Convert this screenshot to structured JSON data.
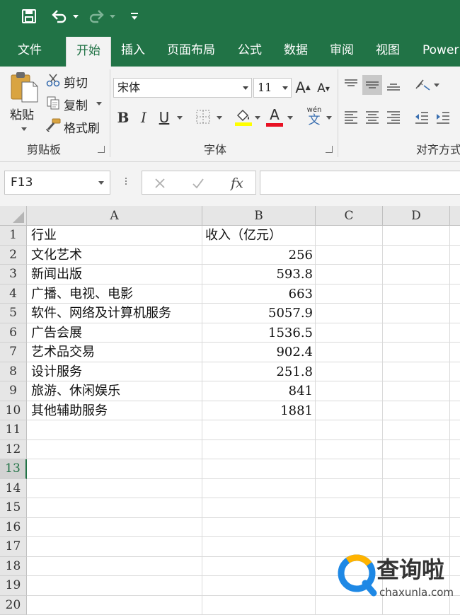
{
  "qat": {
    "save": "save-icon",
    "undo": "undo-icon",
    "redo": "redo-icon",
    "customize": "customize-icon"
  },
  "tabs": [
    "文件",
    "开始",
    "插入",
    "页面布局",
    "公式",
    "数据",
    "审阅",
    "视图",
    "Power"
  ],
  "active_tab": "开始",
  "clipboard": {
    "paste": "粘贴",
    "cut": "剪切",
    "copy": "复制",
    "format_painter": "格式刷",
    "group": "剪贴板"
  },
  "font": {
    "name": "宋体",
    "size": "11",
    "group": "字体",
    "bold": "B",
    "italic": "I",
    "underline": "U",
    "font_color_letter": "A",
    "phonetic_top": "wén",
    "phonetic_bottom": "文",
    "fill_color": "#ffff00",
    "font_color": "#e81123"
  },
  "alignment": {
    "group": "对齐方式"
  },
  "formula_bar": {
    "name_box": "F13",
    "fx": "fx",
    "formula": ""
  },
  "columns": [
    "A",
    "B",
    "C",
    "D"
  ],
  "row_numbers": [
    "1",
    "2",
    "3",
    "4",
    "5",
    "6",
    "7",
    "8",
    "9",
    "10",
    "11",
    "12",
    "13",
    "14",
    "15",
    "16",
    "17",
    "18",
    "19",
    "20"
  ],
  "selected_row": "13",
  "rows": [
    {
      "a": "行业",
      "b": "收入（亿元）"
    },
    {
      "a": "文化艺术",
      "b": "256"
    },
    {
      "a": "新闻出版",
      "b": "593.8"
    },
    {
      "a": "广播、电视、电影",
      "b": "663"
    },
    {
      "a": "软件、网络及计算机服务",
      "b": "5057.9"
    },
    {
      "a": "广告会展",
      "b": "1536.5"
    },
    {
      "a": "艺术品交易",
      "b": "902.4"
    },
    {
      "a": "设计服务",
      "b": "251.8"
    },
    {
      "a": "旅游、休闲娱乐",
      "b": "841"
    },
    {
      "a": "其他辅助服务",
      "b": "1881"
    }
  ],
  "watermark": {
    "title": "查询啦",
    "url": "chaxunla.com"
  },
  "colors": {
    "excel_green": "#217346",
    "ribbon_bg": "#f3f3f3"
  }
}
